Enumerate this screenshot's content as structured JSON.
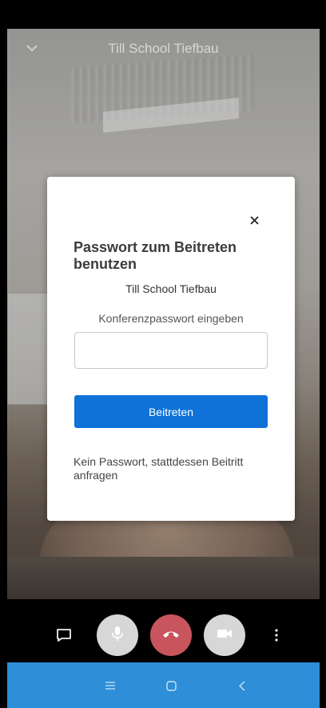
{
  "header": {
    "title": "Till School Tiefbau"
  },
  "dialog": {
    "title": "Passwort zum Beitreten benutzen",
    "meeting_name": "Till School Tiefbau",
    "password_label": "Konferenzpasswort eingeben",
    "password_value": "",
    "join_label": "Beitreten",
    "request_link": "Kein Passwort, stattdessen Beitritt anfragen"
  },
  "controls": {
    "hangup_color": "#c8555e",
    "button_color": "#d7d7d7"
  },
  "navbar": {
    "color": "#2e8ed7"
  },
  "accent": "#0e72d9"
}
